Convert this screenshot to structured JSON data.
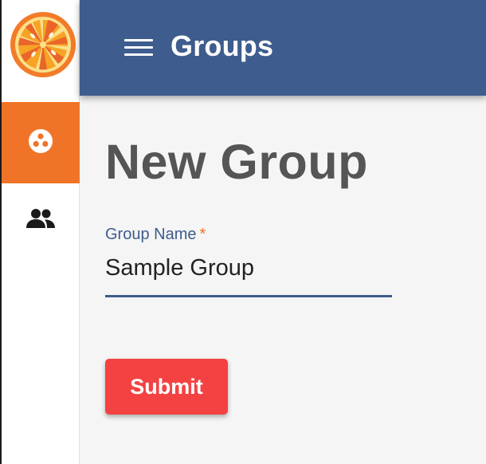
{
  "app": {
    "logo_icon": "orange-slice-icon",
    "brand_colors": {
      "primary": "#3e5c8d",
      "accent": "#f07427",
      "danger": "#f44242"
    }
  },
  "rail": {
    "items": [
      {
        "icon": "groups-icon",
        "active": true
      },
      {
        "icon": "people-icon",
        "active": false
      }
    ]
  },
  "appbar": {
    "menu_icon": "menu-icon",
    "title": "Groups"
  },
  "main": {
    "page_title": "New Group",
    "form": {
      "group_name": {
        "label": "Group Name",
        "required_marker": "*",
        "value": "Sample Group"
      },
      "submit_label": "Submit"
    }
  }
}
